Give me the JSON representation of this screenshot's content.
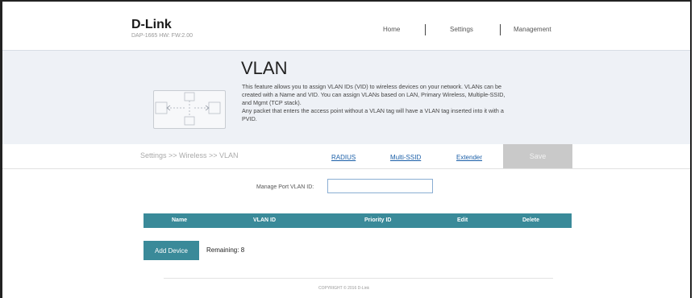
{
  "header": {
    "logo": "D-Link",
    "model": "DAP-1665 HW: FW:2.00",
    "nav": [
      "Home",
      "Settings",
      "Management"
    ]
  },
  "hero": {
    "title": "VLAN",
    "description_lines": [
      "This feature allows you to assign VLAN IDs (VID) to wireless devices on your network. VLANs can be",
      "created with a Name and VID. You can assign VLANs based on LAN, Primary Wireless, Multiple-SSID,",
      "and Mgmt (TCP stack).",
      "Any packet that enters the access point without a VLAN tag will have a VLAN tag inserted into it with a",
      "PVID."
    ]
  },
  "breadcrumb": "Settings >> Wireless >> VLAN",
  "tabs": [
    "RADIUS",
    "Multi-SSID",
    "Extender"
  ],
  "save_label": "Save",
  "form": {
    "manage_label": "Manage Port VLAN ID:",
    "manage_value": ""
  },
  "table": {
    "headers": [
      "Name",
      "VLAN ID",
      "Priority ID",
      "Edit",
      "Delete"
    ]
  },
  "add_device_label": "Add Device",
  "remaining_text": "Remaining: 8",
  "footer": "COPYRIGHT © 2016 D-Link",
  "colors": {
    "accent": "#3a8a99",
    "link": "#1b5fa8",
    "save_disabled": "#c9c9c9",
    "hero_bg": "#eef1f6"
  }
}
